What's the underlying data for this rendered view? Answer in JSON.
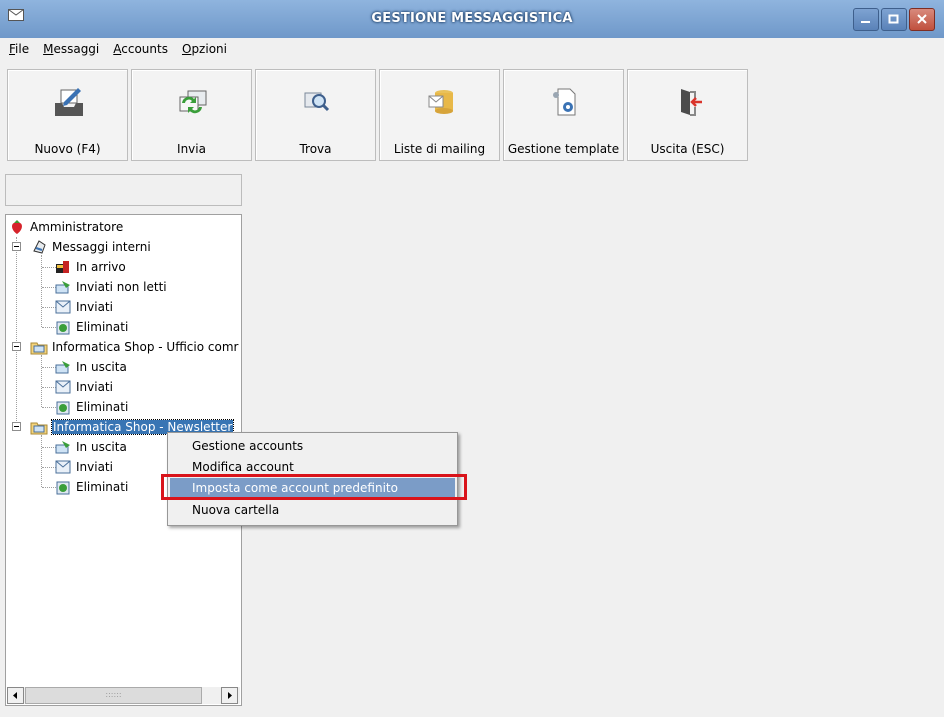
{
  "window": {
    "title": "GESTIONE MESSAGGISTICA"
  },
  "menu": {
    "items": [
      "File",
      "Messaggi",
      "Accounts",
      "Opzioni"
    ]
  },
  "toolbar": {
    "buttons": [
      {
        "label": "Nuovo (F4)",
        "icon": "new-message-icon"
      },
      {
        "label": "Invia",
        "icon": "send-icon"
      },
      {
        "label": "Trova",
        "icon": "find-icon"
      },
      {
        "label": "Liste di mailing",
        "icon": "mailing-list-icon"
      },
      {
        "label": "Gestione template",
        "icon": "template-gear-icon"
      },
      {
        "label": "Uscita (ESC)",
        "icon": "exit-door-icon"
      }
    ]
  },
  "search": {
    "value": ""
  },
  "tree": {
    "root": "Amministratore",
    "accounts": [
      {
        "label": "Messaggi interni",
        "folders": [
          "In arrivo",
          "Inviati non letti",
          "Inviati",
          "Eliminati"
        ]
      },
      {
        "label": "Informatica Shop - Ufficio comr",
        "folders": [
          "In uscita",
          "Inviati",
          "Eliminati"
        ]
      },
      {
        "label": "Informatica Shop - Newsletter",
        "folders": [
          "In uscita",
          "Inviati",
          "Eliminati"
        ],
        "selected": true
      }
    ]
  },
  "scrollbar": {
    "thumb_label": "::::::"
  },
  "context_menu": {
    "items": [
      "Gestione accounts",
      "Modifica account",
      "Imposta come account predefinito",
      "Nuova cartella"
    ],
    "highlighted": "Imposta come account predefinito"
  },
  "colors": {
    "titlebar": "#7ea5d6",
    "selection": "#3875b4",
    "highlight": "#7b9cc7",
    "callout": "#d9141b"
  }
}
